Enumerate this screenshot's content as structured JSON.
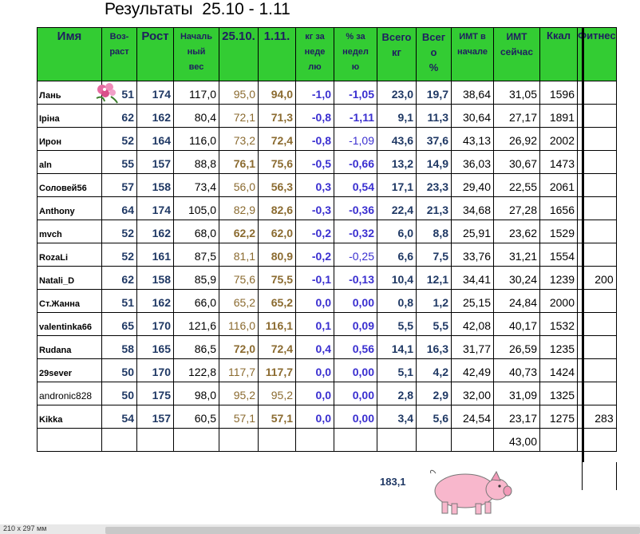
{
  "title": "Результаты  25.10 - 1.11",
  "headers": {
    "name": "Имя",
    "age": [
      "Воз-",
      "раст"
    ],
    "height": "Рост",
    "start_weight": [
      "Началь",
      "ный",
      "вес"
    ],
    "w1": "25.10.",
    "w2": "1.11.",
    "kg_week": [
      "кг за",
      "неде",
      "лю"
    ],
    "pct_week": [
      "% за",
      "недел",
      "ю"
    ],
    "total_kg": [
      "Всего",
      "кг"
    ],
    "total_pct": [
      "Всег",
      "о",
      "%"
    ],
    "bmi_start": [
      "ИМТ в",
      "начале"
    ],
    "bmi_now": [
      "ИМТ",
      "сейчас"
    ],
    "kcal": "Ккал",
    "fitness": "Фитнес"
  },
  "rows": [
    {
      "name": "Лань",
      "age": "51",
      "height": "174",
      "start": "117,0",
      "w1": "95,0",
      "w2": "94,0",
      "kgw": "-1,0",
      "pctw": "-1,05",
      "tkg": "23,0",
      "tpct": "19,7",
      "bmi0": "38,64",
      "bmi1": "31,05",
      "kcal": "1596",
      "fit": ""
    },
    {
      "name": "Іріна",
      "age": "62",
      "height": "162",
      "start": "80,4",
      "w1": "72,1",
      "w2": "71,3",
      "kgw": "-0,8",
      "pctw": "-1,11",
      "tkg": "9,1",
      "tpct": "11,3",
      "bmi0": "30,64",
      "bmi1": "27,17",
      "kcal": "1891",
      "fit": ""
    },
    {
      "name": "Ирон",
      "age": "52",
      "height": "164",
      "start": "116,0",
      "w1": "73,2",
      "w2": "72,4",
      "kgw": "-0,8",
      "pctw": "-1,09",
      "tkg": "43,6",
      "tpct": "37,6",
      "bmi0": "43,13",
      "bmi1": "26,92",
      "kcal": "2002",
      "fit": ""
    },
    {
      "name": "aln",
      "age": "55",
      "height": "157",
      "start": "88,8",
      "w1": "76,1",
      "w2": "75,6",
      "kgw": "-0,5",
      "pctw": "-0,66",
      "tkg": "13,2",
      "tpct": "14,9",
      "bmi0": "36,03",
      "bmi1": "30,67",
      "kcal": "1473",
      "fit": ""
    },
    {
      "name": "Соловей56",
      "age": "57",
      "height": "158",
      "start": "73,4",
      "w1": "56,0",
      "w2": "56,3",
      "kgw": "0,3",
      "pctw": "0,54",
      "tkg": "17,1",
      "tpct": "23,3",
      "bmi0": "29,40",
      "bmi1": "22,55",
      "kcal": "2061",
      "fit": ""
    },
    {
      "name": "Anthony",
      "age": "64",
      "height": "174",
      "start": "105,0",
      "w1": "82,9",
      "w2": "82,6",
      "kgw": "-0,3",
      "pctw": "-0,36",
      "tkg": "22,4",
      "tpct": "21,3",
      "bmi0": "34,68",
      "bmi1": "27,28",
      "kcal": "1656",
      "fit": ""
    },
    {
      "name": "mvch",
      "age": "52",
      "height": "162",
      "start": "68,0",
      "w1": "62,2",
      "w2": "62,0",
      "kgw": "-0,2",
      "pctw": "-0,32",
      "tkg": "6,0",
      "tpct": "8,8",
      "bmi0": "25,91",
      "bmi1": "23,62",
      "kcal": "1529",
      "fit": ""
    },
    {
      "name": "RozaLi",
      "age": "52",
      "height": "161",
      "start": "87,5",
      "w1": "81,1",
      "w2": "80,9",
      "kgw": "-0,2",
      "pctw": "-0,25",
      "tkg": "6,6",
      "tpct": "7,5",
      "bmi0": "33,76",
      "bmi1": "31,21",
      "kcal": "1554",
      "fit": ""
    },
    {
      "name": "Natali_D",
      "age": "62",
      "height": "158",
      "start": "85,9",
      "w1": "75,6",
      "w2": "75,5",
      "kgw": "-0,1",
      "pctw": "-0,13",
      "tkg": "10,4",
      "tpct": "12,1",
      "bmi0": "34,41",
      "bmi1": "30,24",
      "kcal": "1239",
      "fit": "200"
    },
    {
      "name": "Ст.Жанна",
      "age": "51",
      "height": "162",
      "start": "66,0",
      "w1": "65,2",
      "w2": "65,2",
      "kgw": "0,0",
      "pctw": "0,00",
      "tkg": "0,8",
      "tpct": "1,2",
      "bmi0": "25,15",
      "bmi1": "24,84",
      "kcal": "2000",
      "fit": ""
    },
    {
      "name": "valentinka66",
      "age": "65",
      "height": "170",
      "start": "121,6",
      "w1": "116,0",
      "w2": "116,1",
      "kgw": "0,1",
      "pctw": "0,09",
      "tkg": "5,5",
      "tpct": "5,5",
      "bmi0": "42,08",
      "bmi1": "40,17",
      "kcal": "1532",
      "fit": ""
    },
    {
      "name": "Rudana",
      "age": "58",
      "height": "165",
      "start": "86,5",
      "w1": "72,0",
      "w2": "72,4",
      "kgw": "0,4",
      "pctw": "0,56",
      "tkg": "14,1",
      "tpct": "16,3",
      "bmi0": "31,77",
      "bmi1": "26,59",
      "kcal": "1235",
      "fit": ""
    },
    {
      "name": "29sever",
      "age": "50",
      "height": "170",
      "start": "122,8",
      "w1": "117,7",
      "w2": "117,7",
      "kgw": "0,0",
      "pctw": "0,00",
      "tkg": "5,1",
      "tpct": "4,2",
      "bmi0": "42,49",
      "bmi1": "40,73",
      "kcal": "1424",
      "fit": ""
    },
    {
      "name": "andronic828",
      "age": "50",
      "height": "175",
      "start": "98,0",
      "w1": "95,2",
      "w2": "95,2",
      "kgw": "0,0",
      "pctw": "0,00",
      "tkg": "2,8",
      "tpct": "2,9",
      "bmi0": "32,00",
      "bmi1": "31,09",
      "kcal": "1325",
      "fit": ""
    },
    {
      "name": "Kikka",
      "age": "54",
      "height": "157",
      "start": "60,5",
      "w1": "57,1",
      "w2": "57,1",
      "kgw": "0,0",
      "pctw": "0,00",
      "tkg": "3,4",
      "tpct": "5,6",
      "bmi0": "24,54",
      "bmi1": "23,17",
      "kcal": "1275",
      "fit": "283"
    }
  ],
  "bmi_average": "43,00",
  "total_lost": "183,1",
  "paper_size": "210 x 297 мм"
}
